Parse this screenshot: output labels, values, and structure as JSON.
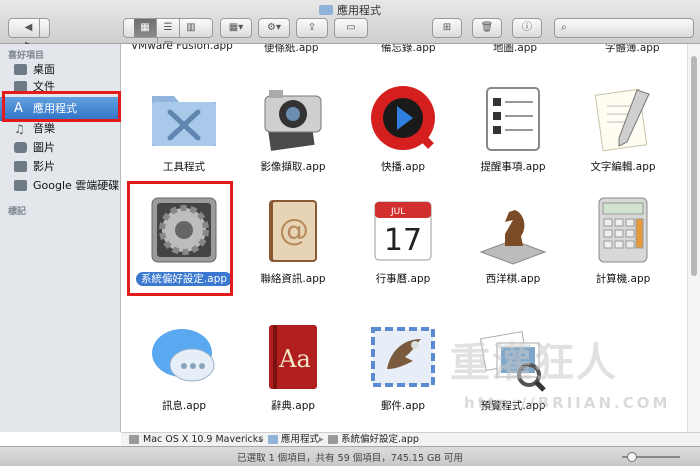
{
  "window": {
    "title": "應用程式"
  },
  "toolbar": {
    "back_icon": "chevron-left-icon",
    "forward_icon": "chevron-right-icon",
    "view_modes": [
      "icon-view",
      "list-view",
      "column-view",
      "coverflow-view"
    ],
    "selected_view": "icon-view"
  },
  "sidebar": {
    "favorites_header": "喜好項目",
    "items": [
      {
        "label": "桌面",
        "icon": "desktop-icon",
        "selected": false
      },
      {
        "label": "文件",
        "icon": "documents-icon",
        "selected": false
      },
      {
        "label": "應用程式",
        "icon": "applications-icon",
        "selected": true
      },
      {
        "label": "音樂",
        "icon": "music-icon",
        "selected": false
      },
      {
        "label": "圖片",
        "icon": "camera-icon",
        "selected": false
      },
      {
        "label": "影片",
        "icon": "movies-icon",
        "selected": false
      },
      {
        "label": "Google 雲端硬碟",
        "icon": "folder-icon",
        "selected": false
      }
    ],
    "tags_header": "標記"
  },
  "content": {
    "partial_row": [
      "VMware Fusion.app",
      "便條紙.app",
      "備忘錄.app",
      "地圖.app",
      "字體簿.app"
    ],
    "items": [
      {
        "label": "工具程式",
        "icon": "utilities-folder-icon"
      },
      {
        "label": "影像擷取.app",
        "icon": "image-capture-icon"
      },
      {
        "label": "快播.app",
        "icon": "qvod-player-icon"
      },
      {
        "label": "提醒事項.app",
        "icon": "reminders-icon"
      },
      {
        "label": "文字編輯.app",
        "icon": "textedit-icon"
      },
      {
        "label": "系統偏好設定.app",
        "icon": "system-preferences-icon",
        "selected": true
      },
      {
        "label": "聯絡資訊.app",
        "icon": "contacts-icon"
      },
      {
        "label": "行事曆.app",
        "icon": "calendar-icon",
        "cal_month": "JUL",
        "cal_day": "17"
      },
      {
        "label": "西洋棋.app",
        "icon": "chess-icon"
      },
      {
        "label": "計算機.app",
        "icon": "calculator-icon"
      },
      {
        "label": "訊息.app",
        "icon": "messages-icon"
      },
      {
        "label": "辭典.app",
        "icon": "dictionary-icon",
        "dict_text": "Aa"
      },
      {
        "label": "郵件.app",
        "icon": "mail-icon"
      },
      {
        "label": "預覽程式.app",
        "icon": "preview-icon"
      }
    ]
  },
  "pathbar": {
    "segments": [
      "Mac OS X 10.9 Mavericks",
      "應用程式",
      "系統偏好設定.app"
    ]
  },
  "status": {
    "text": "已選取 1 個項目，共有 59 個項目，745.15 GB 可用"
  },
  "watermark": {
    "text": "重灌狂人",
    "url": "http://BRIIAN.COM"
  },
  "colors": {
    "selection": "#3a79cf",
    "highlight_box": "#e21c1c",
    "sidebar_bg": "#e3e7ec"
  }
}
